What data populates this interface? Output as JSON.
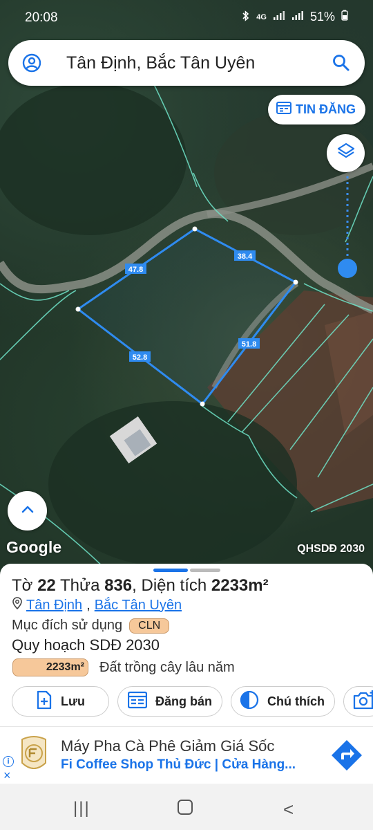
{
  "status": {
    "time": "20:08",
    "network": "4G",
    "battery": "51%"
  },
  "search": {
    "text": "Tân Định, Bắc Tân Uyên"
  },
  "map": {
    "tin_dang_label": "TIN ĐĂNG",
    "google_label": "Google",
    "layer_label": "QHSDĐ 2030",
    "edge_labels": [
      "47.8",
      "38.4",
      "51.8",
      "52.8"
    ]
  },
  "parcel": {
    "prefix": "Tờ",
    "sheet_no": "22",
    "plot_word": "Thửa",
    "plot_no": "836",
    "area_word": ", Diện tích",
    "area": "2233m²",
    "commune": "Tân Định",
    "district": "Bắc Tân Uyên",
    "separator": ",",
    "purpose_label": "Mục đích sử dụng",
    "purpose_code": "CLN",
    "planning_label": "Quy hoạch SDĐ 2030",
    "planning_area": "2233m²",
    "planning_desc": "Đất trồng cây lâu năm"
  },
  "actions": {
    "save": "Lưu",
    "post": "Đăng bán",
    "legend": "Chú thích"
  },
  "ad": {
    "title": "Máy Pha Cà Phê Giảm Giá Sốc",
    "subtitle": "Fi Coffee Shop Thủ Đức | Cửa Hàng...",
    "info_icon": "i",
    "close_icon": "×"
  },
  "nav": {
    "recent": "|||",
    "back": "<"
  },
  "colors": {
    "accent": "#1a73e8",
    "badge": "#f6c89a",
    "parcel_line": "#2f8bf0",
    "boundary": "#6fe3c8"
  }
}
